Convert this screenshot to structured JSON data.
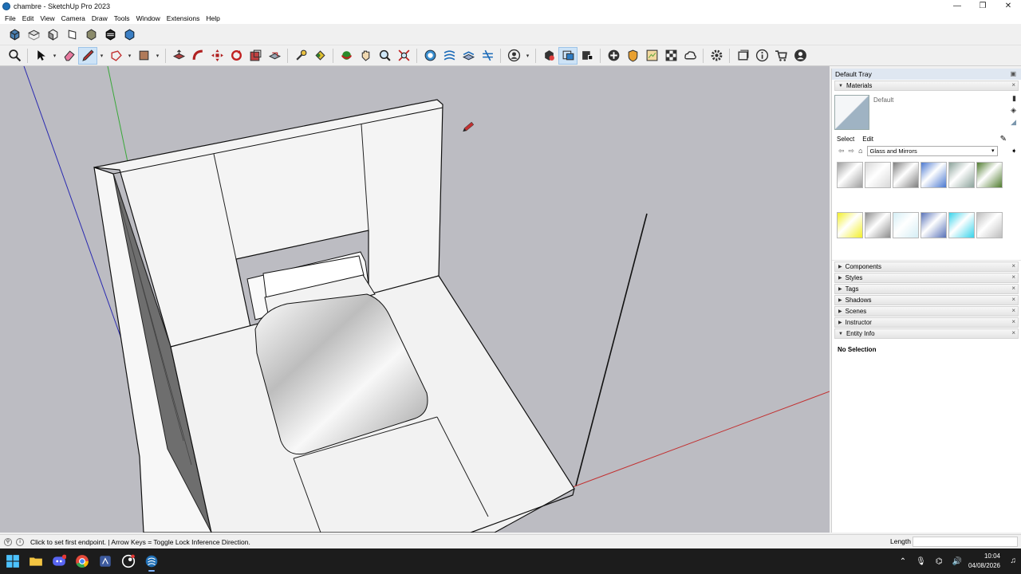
{
  "window": {
    "title": "chambre - SketchUp Pro 2023",
    "minimize": "—",
    "maximize": "❐",
    "close": "✕"
  },
  "menu": [
    "File",
    "Edit",
    "View",
    "Camera",
    "Draw",
    "Tools",
    "Window",
    "Extensions",
    "Help"
  ],
  "toolbar_views": [
    "iso-view-icon",
    "top-view-icon",
    "front-view-icon",
    "right-view-icon",
    "back-view-icon",
    "left-view-icon",
    "xray-icon"
  ],
  "tray": {
    "title": "Default Tray",
    "pin": "▣",
    "materials": {
      "header": "Materials",
      "current_name": "Default",
      "tab_select": "Select",
      "tab_edit": "Edit",
      "library": "Glass and Mirrors",
      "swatch_colors": [
        "#9d9d9d",
        "#d8d8d8",
        "#7e7e7e",
        "#4a78d0",
        "#8ba29a",
        "#4f7b2e",
        "#f2ef2a",
        "#8d8d8d",
        "#d5eef5",
        "#5872b8",
        "#38d3ea",
        "#bdbdbd"
      ]
    },
    "panels": [
      "Components",
      "Styles",
      "Tags",
      "Shadows",
      "Scenes",
      "Instructor",
      "Entity Info"
    ],
    "entity_info": {
      "status": "No Selection"
    }
  },
  "status": {
    "message": "Click to set first endpoint. | Arrow Keys = Toggle Lock Inference Direction.",
    "vcb_label": "Length",
    "vcb_value": ""
  },
  "taskbar": {
    "time": "10:04",
    "date": "04/08/2026"
  },
  "colors": {
    "viewport_bg": "#bcbcc2",
    "axis_red": "#c23030",
    "axis_green": "#3aa83a",
    "axis_blue": "#2a2ab0"
  }
}
